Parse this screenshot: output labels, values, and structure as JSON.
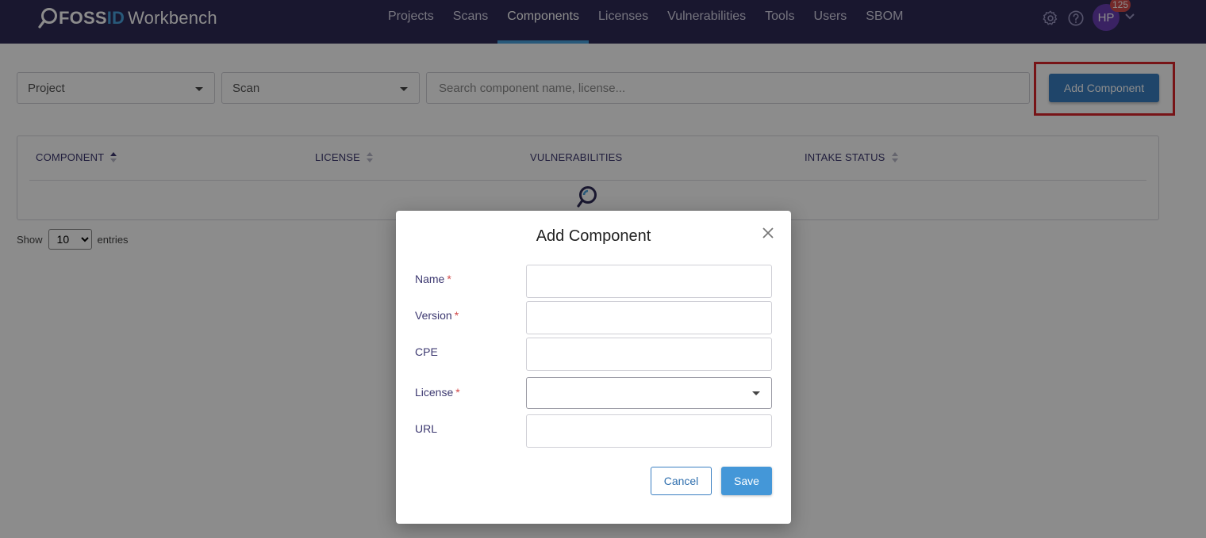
{
  "app": {
    "brand_fossid_foss": "FOSS",
    "brand_fossid_id": "ID",
    "brand_product": "Workbench",
    "accent_color": "#4aa3df",
    "header_color": "#2f2b56"
  },
  "nav": {
    "items": [
      {
        "label": "Projects"
      },
      {
        "label": "Scans"
      },
      {
        "label": "Components",
        "active": true
      },
      {
        "label": "Licenses"
      },
      {
        "label": "Vulnerabilities"
      },
      {
        "label": "Tools"
      },
      {
        "label": "Users"
      },
      {
        "label": "SBOM"
      }
    ]
  },
  "header_right": {
    "settings_icon": "gear-icon",
    "help_icon": "question-circle-icon",
    "avatar_initials": "HP",
    "notification_count": "125",
    "menu_icon": "chevron-down-icon"
  },
  "filters": {
    "project_label": "Project",
    "scan_label": "Scan",
    "search_placeholder": "Search component name, license...",
    "add_button": "Add Component"
  },
  "table": {
    "columns": [
      {
        "label": "COMPONENT",
        "sortable": true,
        "sort": "asc"
      },
      {
        "label": "LICENSE",
        "sortable": true
      },
      {
        "label": "VULNERABILITIES",
        "sortable": false
      },
      {
        "label": "INTAKE STATUS",
        "sortable": true
      }
    ],
    "loading_icon": "search-loader-icon"
  },
  "pagination": {
    "show_label": "Show",
    "page_size": "10",
    "entries_label": "entries"
  },
  "modal": {
    "title": "Add Component",
    "fields": [
      {
        "label": "Name",
        "required": true,
        "type": "text"
      },
      {
        "label": "Version",
        "required": true,
        "type": "text"
      },
      {
        "label": "CPE",
        "required": false,
        "type": "text"
      },
      {
        "label": "License",
        "required": true,
        "type": "select"
      },
      {
        "label": "URL",
        "required": false,
        "type": "text"
      }
    ],
    "cancel_label": "Cancel",
    "save_label": "Save"
  },
  "annotation": {
    "highlight_color": "#d9262a"
  }
}
